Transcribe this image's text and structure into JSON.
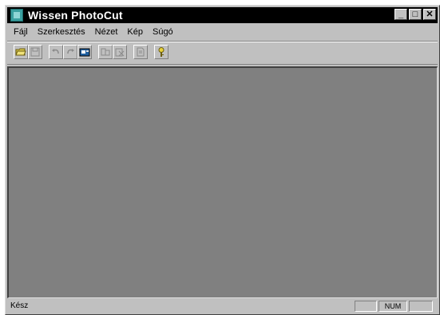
{
  "window": {
    "title": "Wissen PhotoCut",
    "app_icon": "photocut-app-icon",
    "caption_buttons": {
      "minimize": "_",
      "maximize": "□",
      "close": "✕"
    }
  },
  "menu": {
    "items": [
      {
        "label": "Fájl"
      },
      {
        "label": "Szerkesztés"
      },
      {
        "label": "Nézet"
      },
      {
        "label": "Kép"
      },
      {
        "label": "Súgó"
      }
    ]
  },
  "toolbar": {
    "buttons": [
      {
        "icon": "open-folder-icon",
        "enabled": true
      },
      {
        "icon": "save-icon",
        "enabled": false
      },
      {
        "icon": "undo-icon",
        "enabled": false
      },
      {
        "icon": "redo-icon",
        "enabled": false
      },
      {
        "icon": "capture-icon",
        "enabled": true
      },
      {
        "icon": "cut-icon",
        "enabled": false
      },
      {
        "icon": "paste-icon",
        "enabled": false
      },
      {
        "icon": "page-icon",
        "enabled": false
      },
      {
        "icon": "help-icon",
        "enabled": true
      }
    ]
  },
  "statusbar": {
    "text": "Kész",
    "num_indicator": "NUM"
  },
  "colors": {
    "titlebar_bg": "#000000",
    "window_bg": "#c0c0c0",
    "workspace_bg": "#808080"
  }
}
